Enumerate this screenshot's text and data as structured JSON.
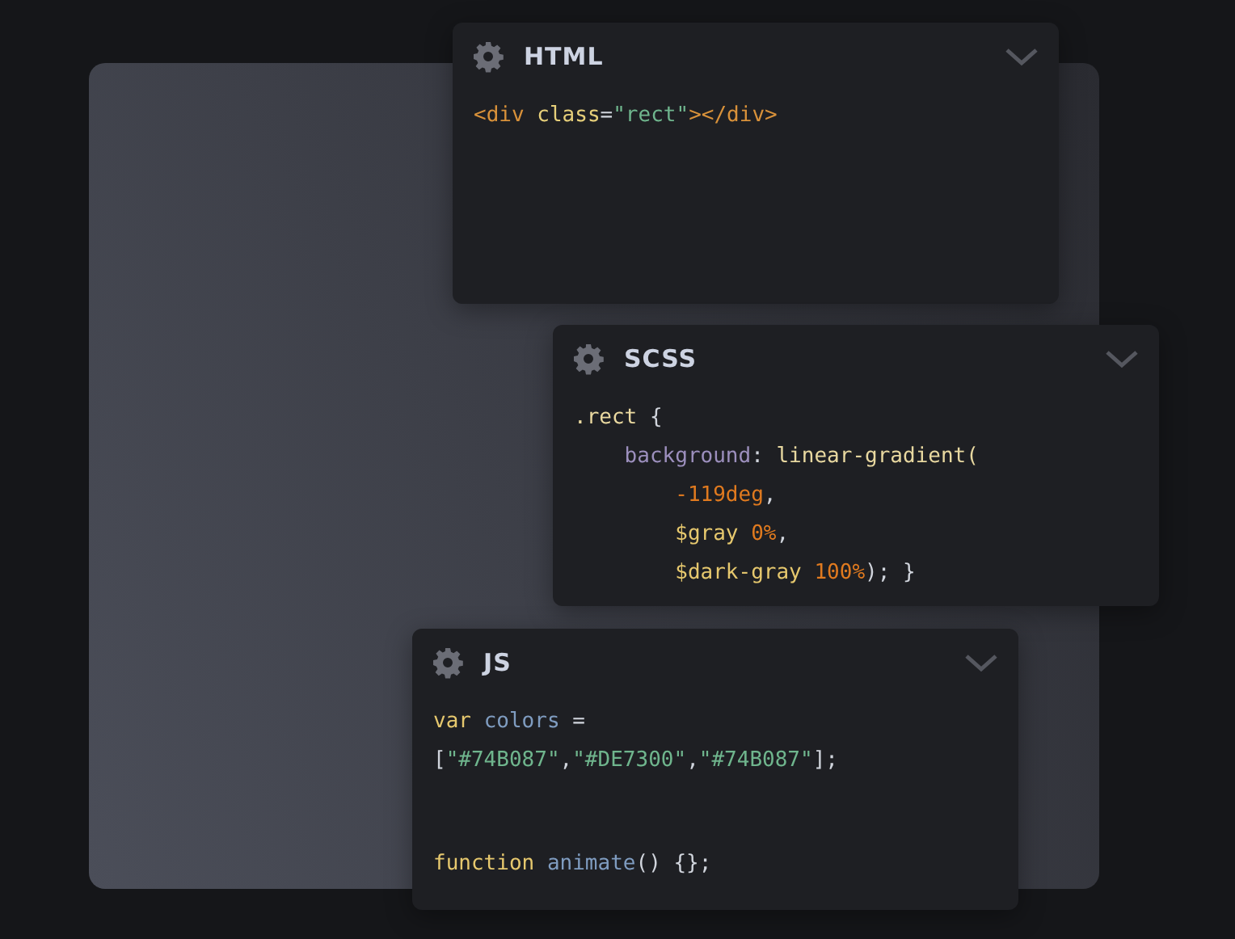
{
  "panels": [
    {
      "title": "HTML",
      "blocks": [
        {
          "lines": [
            {
              "tokens": [
                {
                  "text": "<div ",
                  "kind": "tag"
                },
                {
                  "text": "class",
                  "kind": "attr"
                },
                {
                  "text": "=",
                  "kind": "punct"
                },
                {
                  "text": "\"rect\"",
                  "kind": "string"
                },
                {
                  "text": "></div>",
                  "kind": "tag"
                }
              ]
            }
          ]
        }
      ]
    },
    {
      "title": "SCSS",
      "blocks": [
        {
          "lines": [
            {
              "tokens": [
                {
                  "text": ".rect",
                  "kind": "selector"
                },
                {
                  "text": " {",
                  "kind": "punct"
                }
              ]
            },
            {
              "tokens": [
                {
                  "text": "    background",
                  "kind": "property"
                },
                {
                  "text": ": ",
                  "kind": "punct"
                },
                {
                  "text": "linear-gradient(",
                  "kind": "func"
                }
              ]
            },
            {
              "tokens": [
                {
                  "text": "        -119deg",
                  "kind": "number"
                },
                {
                  "text": ",",
                  "kind": "punct"
                }
              ]
            },
            {
              "tokens": [
                {
                  "text": "        $gray",
                  "kind": "variable"
                },
                {
                  "text": " 0%",
                  "kind": "number"
                },
                {
                  "text": ",",
                  "kind": "punct"
                }
              ]
            },
            {
              "tokens": [
                {
                  "text": "        $dark-gray",
                  "kind": "variable"
                },
                {
                  "text": " 100%",
                  "kind": "number"
                },
                {
                  "text": "); }",
                  "kind": "punct"
                }
              ]
            }
          ]
        }
      ]
    },
    {
      "title": "JS",
      "blocks": [
        {
          "lines": [
            {
              "tokens": [
                {
                  "text": "var ",
                  "kind": "keyword"
                },
                {
                  "text": "colors",
                  "kind": "ident"
                },
                {
                  "text": " =",
                  "kind": "punct"
                }
              ]
            },
            {
              "tokens": [
                {
                  "text": "[",
                  "kind": "punct"
                },
                {
                  "text": "\"#74B087\"",
                  "kind": "string"
                },
                {
                  "text": ",",
                  "kind": "punct"
                },
                {
                  "text": "\"#DE7300\"",
                  "kind": "string"
                },
                {
                  "text": ",",
                  "kind": "punct"
                },
                {
                  "text": "\"#74B087\"",
                  "kind": "string"
                },
                {
                  "text": "];",
                  "kind": "punct"
                }
              ]
            }
          ]
        },
        {
          "lines": [
            {
              "tokens": [
                {
                  "text": "function ",
                  "kind": "keyword"
                },
                {
                  "text": "animate",
                  "kind": "ident"
                },
                {
                  "text": "() {};",
                  "kind": "punct"
                }
              ]
            }
          ]
        }
      ]
    }
  ]
}
